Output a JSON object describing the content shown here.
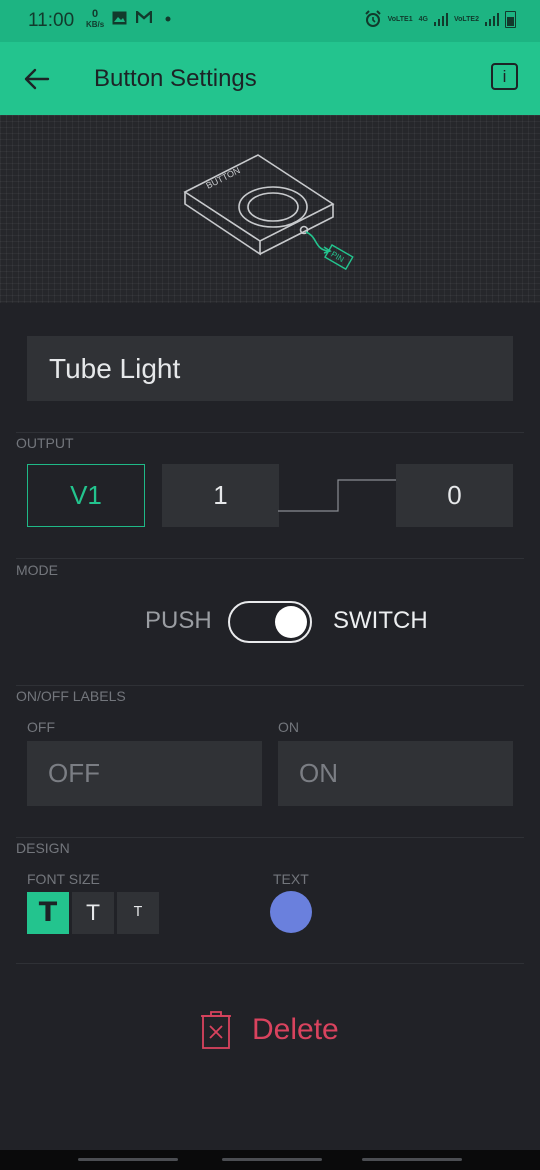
{
  "status_bar": {
    "time": "11:00",
    "net_speed_value": "0",
    "net_speed_unit": "KB/s",
    "sim1_label": "VoLTE1",
    "sim1_tech": "4G",
    "sim2_label": "VoLTE2",
    "icons": [
      "image-icon",
      "gmail-icon",
      "dot-icon",
      "alarm-icon",
      "signal-icon",
      "battery-icon"
    ]
  },
  "app_bar": {
    "title": "Button Settings",
    "info_label": "i"
  },
  "illustration": {
    "button_text": "BUTTON",
    "pin_text": "PIN"
  },
  "name_field": {
    "value": "Tube Light"
  },
  "output": {
    "section_label": "OUTPUT",
    "pin": "V1",
    "high_value": "1",
    "low_value": "0"
  },
  "mode": {
    "section_label": "MODE",
    "left_label": "PUSH",
    "right_label": "SWITCH",
    "selected": "SWITCH"
  },
  "labels": {
    "section_label": "ON/OFF LABELS",
    "off_caption": "OFF",
    "on_caption": "ON",
    "off_placeholder": "OFF",
    "on_placeholder": "ON"
  },
  "design": {
    "section_label": "DESIGN",
    "font_size_caption": "FONT SIZE",
    "text_caption": "TEXT",
    "font_sizes": [
      "T",
      "T",
      "T"
    ],
    "selected_font_size": 0,
    "text_color": "#6a80dd"
  },
  "delete": {
    "label": "Delete"
  },
  "colors": {
    "accent": "#23c48e",
    "background": "#212227",
    "danger": "#d9435e"
  }
}
